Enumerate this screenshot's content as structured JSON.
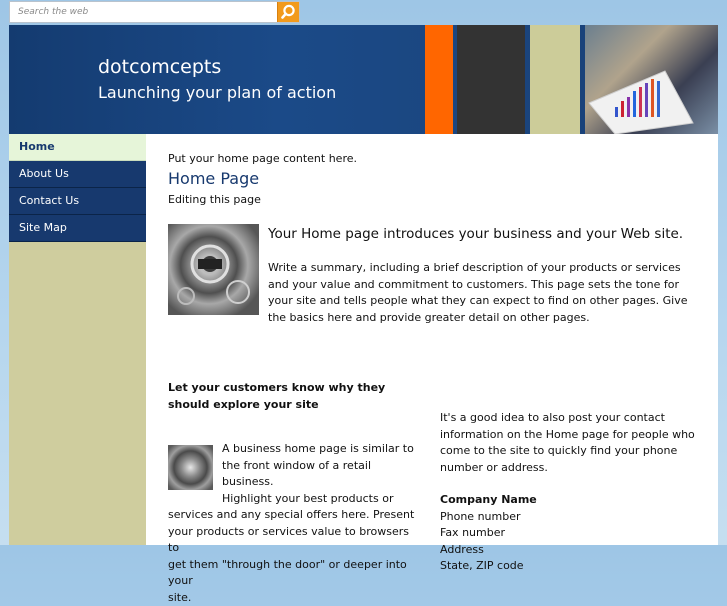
{
  "search": {
    "placeholder": "Search the web",
    "button_icon": "search-icon"
  },
  "header": {
    "brand": "dotcomcepts",
    "tagline": "Launching your plan of action",
    "stripe_colors": [
      "#ff6600",
      "#333333",
      "#cccc99"
    ]
  },
  "nav": {
    "items": [
      {
        "label": "Home",
        "active": true
      },
      {
        "label": "About Us",
        "active": false
      },
      {
        "label": "Contact Us",
        "active": false
      },
      {
        "label": "Site Map",
        "active": false
      }
    ]
  },
  "content": {
    "intro": "Put your home page content here.",
    "title": "Home Page",
    "subtitle": "Editing this page",
    "hero_heading": "Your Home page introduces your business and your Web site.",
    "hero_body": "Write a summary, including a brief description of your products or services and your value and commitment to customers. This page sets the tone for your site and tells people what they can expect to find on other pages. Give the basics here and provide greater detail on other pages.",
    "left_heading": "Let your customers know why they should explore your site",
    "left_body_lines": [
      "A business home page is similar to",
      "the front window of a retail business.",
      "Highlight your best products or",
      "services and any special offers here. Present",
      "your products or services value to browsers to",
      "get them \"through the door\" or deeper into your",
      "site."
    ],
    "right_intro": "It's a good idea to also post your contact information on the Home page for people who come to the site to quickly find your phone number or address.",
    "company_name": "Company Name",
    "contact_lines": [
      "Phone number",
      "Fax number",
      "Address",
      "State, ZIP code"
    ]
  }
}
